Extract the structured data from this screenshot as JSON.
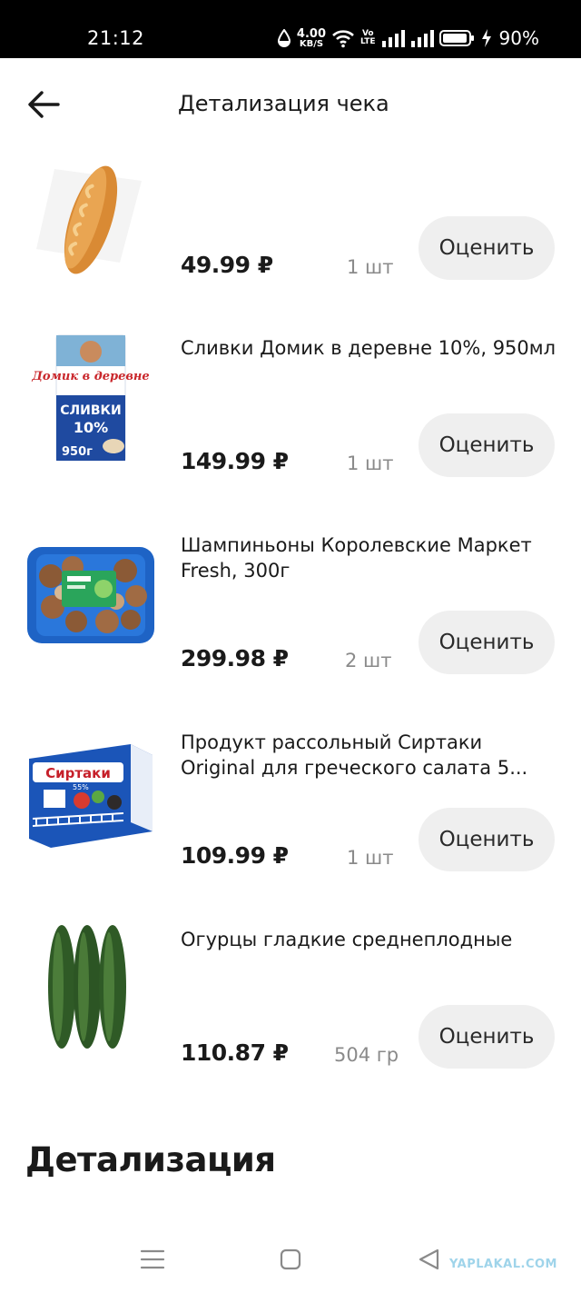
{
  "status_bar": {
    "time": "21:12",
    "net_speed_value": "4.00",
    "net_speed_unit": "KB/S",
    "volte_top": "Vo",
    "volte_bottom": "LTE",
    "battery": "90%"
  },
  "header": {
    "title": "Детализация чека",
    "back_icon": "arrow-left-icon"
  },
  "items": [
    {
      "name": "",
      "price": "49.99 ₽",
      "qty": "1 шт",
      "rate_label": "Оценить",
      "image": "baguette"
    },
    {
      "name": "Сливки Домик в деревне 10%, 950мл",
      "price": "149.99 ₽",
      "qty": "1 шт",
      "rate_label": "Оценить",
      "image": "cream-carton",
      "image_text": {
        "brand": "Домик в деревне",
        "product": "СЛИВКИ",
        "fat": "10%",
        "weight": "950г"
      }
    },
    {
      "name": "Шампиньоны Королевские Маркет Fresh, 300г",
      "price": "299.98 ₽",
      "qty": "2 шт",
      "rate_label": "Оценить",
      "image": "mushrooms-tray"
    },
    {
      "name": "Продукт рассольный Сиртаки Original для греческого салата 5...",
      "price": "109.99 ₽",
      "qty": "1 шт",
      "rate_label": "Оценить",
      "image": "cheese-box",
      "image_text": {
        "brand": "Сиртаки",
        "fat": "55%"
      }
    },
    {
      "name": "Огурцы гладкие среднеплодные",
      "price": "110.87 ₽",
      "qty": "504 гр",
      "rate_label": "Оценить",
      "image": "cucumbers"
    }
  ],
  "section": {
    "title": "Детализация"
  },
  "nav": {
    "menu_icon": "menu-icon",
    "home_icon": "home-square-icon",
    "back_icon": "back-triangle-icon"
  },
  "watermark": "YAPLAKAL.COM"
}
